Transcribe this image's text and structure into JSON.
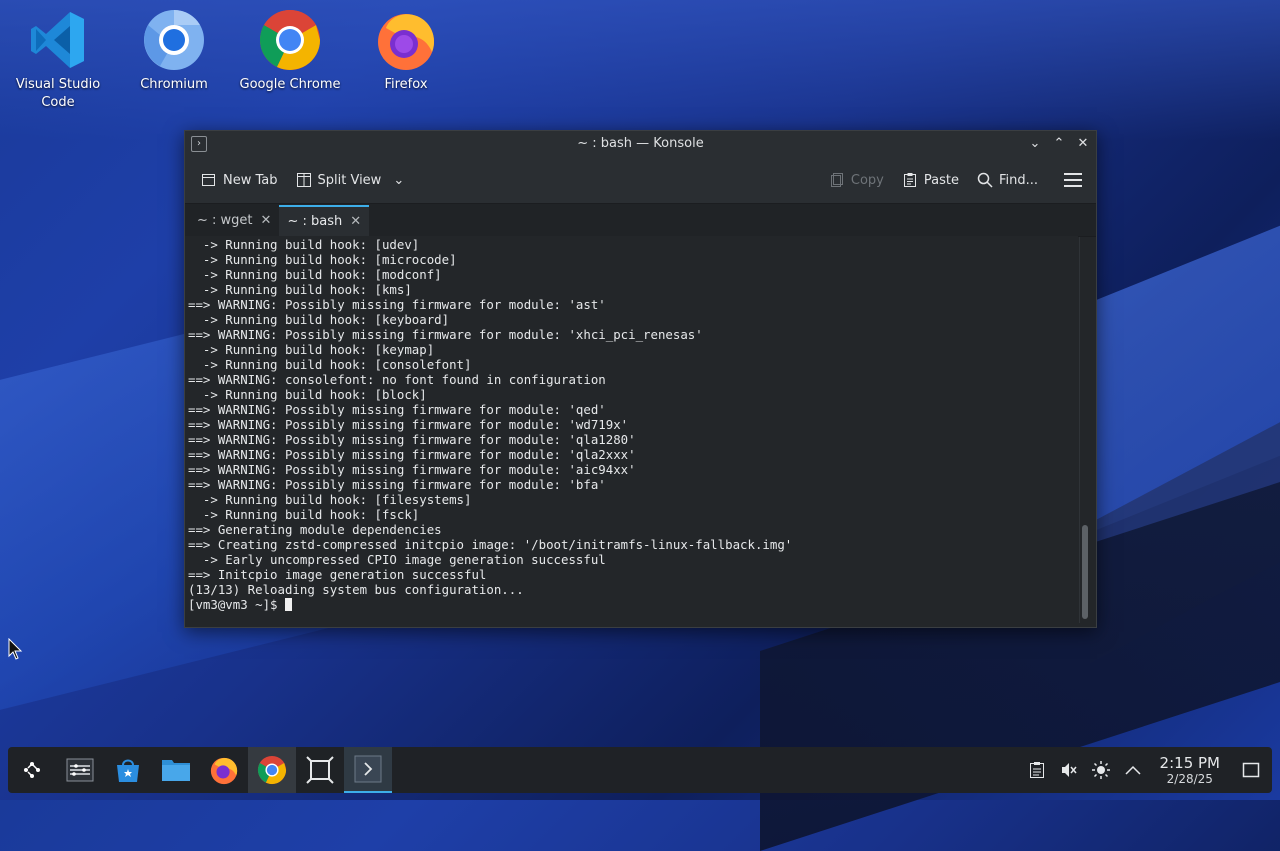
{
  "desktop": {
    "icons": [
      {
        "label": "Visual Studio Code",
        "icon": "vscode-icon"
      },
      {
        "label": "Chromium",
        "icon": "chromium-icon"
      },
      {
        "label": "Google Chrome",
        "icon": "chrome-icon"
      },
      {
        "label": "Firefox",
        "icon": "firefox-icon"
      }
    ]
  },
  "window": {
    "title": "~ : bash — Konsole",
    "toolbar": {
      "new_tab": "New Tab",
      "split_view": "Split View",
      "copy": "Copy",
      "paste": "Paste",
      "find": "Find..."
    },
    "tabs": [
      {
        "label": "~ : wget"
      },
      {
        "label": "~ : bash"
      }
    ],
    "terminal_lines": [
      "  -> Running build hook: [udev]",
      "  -> Running build hook: [microcode]",
      "  -> Running build hook: [modconf]",
      "  -> Running build hook: [kms]",
      "==> WARNING: Possibly missing firmware for module: 'ast'",
      "  -> Running build hook: [keyboard]",
      "==> WARNING: Possibly missing firmware for module: 'xhci_pci_renesas'",
      "  -> Running build hook: [keymap]",
      "  -> Running build hook: [consolefont]",
      "==> WARNING: consolefont: no font found in configuration",
      "  -> Running build hook: [block]",
      "==> WARNING: Possibly missing firmware for module: 'qed'",
      "==> WARNING: Possibly missing firmware for module: 'wd719x'",
      "==> WARNING: Possibly missing firmware for module: 'qla1280'",
      "==> WARNING: Possibly missing firmware for module: 'qla2xxx'",
      "==> WARNING: Possibly missing firmware for module: 'aic94xx'",
      "==> WARNING: Possibly missing firmware for module: 'bfa'",
      "  -> Running build hook: [filesystems]",
      "  -> Running build hook: [fsck]",
      "==> Generating module dependencies",
      "==> Creating zstd-compressed initcpio image: '/boot/initramfs-linux-fallback.img'",
      "  -> Early uncompressed CPIO image generation successful",
      "==> Initcpio image generation successful",
      "(13/13) Reloading system bus configuration..."
    ],
    "prompt": "[vm3@vm3 ~]$ "
  },
  "taskbar": {
    "items": [
      "app-launcher-icon",
      "overview-icon",
      "discover-icon",
      "file-manager-icon",
      "firefox-icon",
      "chrome-icon",
      "window-manager-icon",
      "konsole-icon"
    ],
    "clock_time": "2:15 PM",
    "clock_date": "2/28/25"
  },
  "colors": {
    "accent": "#3daee9",
    "terminal_bg": "#232629",
    "terminal_fg": "#e6e8ea"
  }
}
